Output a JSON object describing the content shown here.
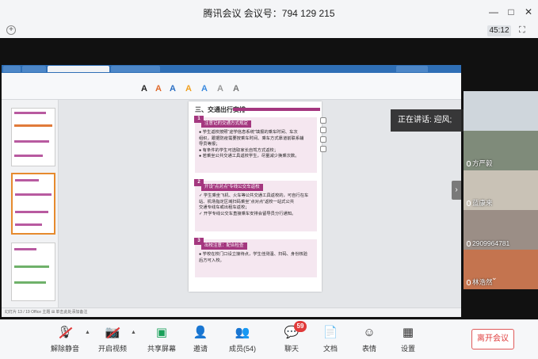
{
  "window": {
    "title": "腾讯会议 会议号：794 129 215",
    "minimize": "—",
    "maximize": "□",
    "close": "✕"
  },
  "topbar": {
    "add": "+",
    "timer": "45:12",
    "fullscreen": "⛶"
  },
  "speaking": {
    "text": "正在讲话: 迎风;"
  },
  "slide": {
    "title": "三、交通出行安排",
    "sections": [
      {
        "num": "1",
        "heading": "注意记的交通方式规定",
        "lines": [
          "● 学生返校按照“迎学信息系统”填报的乘车时间、车次",
          "  组织，跟据防疫需要按乘车时间、乘车方式靠道前联系辅",
          "  导员等报；",
          "● 有条件的学生可选取家长自驾方式返校；",
          "● 若乘坐公共交通工具返校学生，尽量减少换乘次数。"
        ]
      },
      {
        "num": "2",
        "heading": "开设“点对点”专线公交车返校",
        "lines": [
          "✓ 学生乘坐飞机、火车等公共交通工具返校的，可自行在车",
          "  站、机场指定区域扫码乘坐“点对点”返校一站式公共",
          "  交通专线车或出租车返校；",
          "✓ 开学专线公交车直接乘车安排会留导员分行通知。"
        ]
      },
      {
        "num": "3",
        "heading": "出校注意：配合检查",
        "lines": [
          "● 学校在校门口设立接待点，学生佳测温、扫码、身份核验",
          "  后方可入校。"
        ]
      }
    ]
  },
  "wps": {
    "status": "幻灯片 13 / 19    Office 主题    ⊞ 单击此处添加备注"
  },
  "participants": [
    {
      "name": "",
      "color": "#cfd6dc"
    },
    {
      "name": "方严毅",
      "color": "#7f8b7a"
    },
    {
      "name": "蓝康来",
      "color": "#c9c2b6"
    },
    {
      "name": "2909964781",
      "color": "#9b8e86"
    },
    {
      "name": "林浩然",
      "color": "#c4744f"
    }
  ],
  "controls": {
    "unmute": "解除静音",
    "video": "开启视频",
    "share": "共享屏幕",
    "invite": "邀请",
    "members": "成员(54)",
    "chat": "聊天",
    "chat_badge": "59",
    "docs": "文档",
    "emoji": "表情",
    "settings": "设置",
    "leave": "离开会议"
  }
}
